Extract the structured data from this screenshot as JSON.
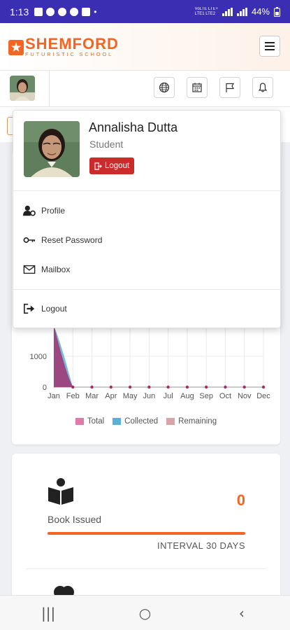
{
  "status_bar": {
    "time": "1:13",
    "network_top": "VoLTE LTE+",
    "network_bottom": "LTE1 LTE2",
    "battery": "44%"
  },
  "header": {
    "logo_name": "SHEMFORD",
    "logo_tagline": "FUTURISTIC SCHOOL"
  },
  "toolbar": {
    "icons": [
      "globe-icon",
      "calendar-icon",
      "flag-icon",
      "bell-icon"
    ]
  },
  "dropdown": {
    "name": "Annalisha Dutta",
    "role": "Student",
    "logout_button": "Logout",
    "menu": [
      {
        "label": "Profile",
        "icon": "user-cog-icon"
      },
      {
        "label": "Reset Password",
        "icon": "key-icon"
      },
      {
        "label": "Mailbox",
        "icon": "envelope-icon"
      }
    ],
    "logout_item": "Logout"
  },
  "chart_data": {
    "type": "area",
    "categories": [
      "Jan",
      "Feb",
      "Mar",
      "Apr",
      "May",
      "Jun",
      "Jul",
      "Aug",
      "Sep",
      "Oct",
      "Nov",
      "Dec"
    ],
    "y_ticks": [
      "0",
      "1000"
    ],
    "ylim": [
      0,
      1000
    ],
    "series": [
      {
        "name": "Total",
        "color": "#e07aa8",
        "values": [
          3200,
          0,
          0,
          0,
          0,
          0,
          0,
          0,
          0,
          0,
          0,
          0
        ]
      },
      {
        "name": "Collected",
        "color": "#5ab0d8",
        "values": [
          3200,
          0,
          0,
          0,
          0,
          0,
          0,
          0,
          0,
          0,
          0,
          0
        ]
      },
      {
        "name": "Remaining",
        "color": "#d9a3aa",
        "values": [
          0,
          0,
          0,
          0,
          0,
          0,
          0,
          0,
          0,
          0,
          0,
          0
        ]
      }
    ]
  },
  "book_card": {
    "label": "Book Issued",
    "value": "0",
    "interval": "INTERVAL 30 DAYS"
  },
  "nav_bar": {
    "recents": "|||",
    "home": "○",
    "back": "‹"
  }
}
